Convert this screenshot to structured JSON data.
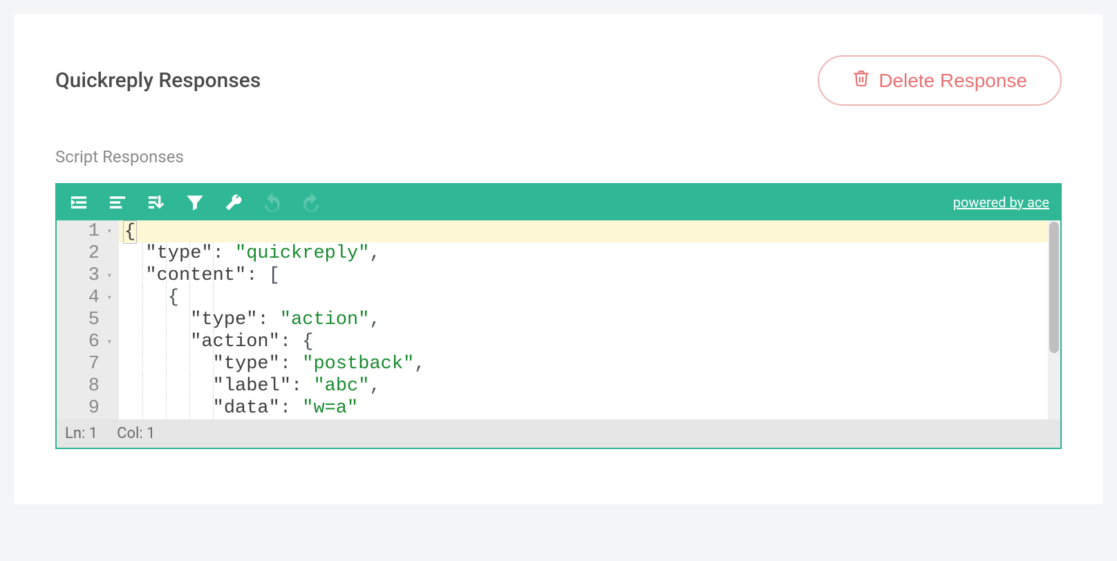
{
  "header": {
    "title": "Quickreply Responses",
    "delete_label": "Delete Response"
  },
  "section": {
    "label": "Script Responses"
  },
  "toolbar": {
    "powered_label": "powered by ace"
  },
  "editor": {
    "lines": [
      {
        "num": "1",
        "fold": true,
        "segments": [
          {
            "t": "{",
            "c": "key",
            "hl": true
          }
        ]
      },
      {
        "num": "2",
        "fold": false,
        "segments": [
          {
            "t": "  ",
            "c": ""
          },
          {
            "t": "\"type\"",
            "c": "key"
          },
          {
            "t": ": ",
            "c": "pun"
          },
          {
            "t": "\"quickreply\"",
            "c": "str"
          },
          {
            "t": ",",
            "c": "pun"
          }
        ]
      },
      {
        "num": "3",
        "fold": true,
        "segments": [
          {
            "t": "  ",
            "c": ""
          },
          {
            "t": "\"content\"",
            "c": "key"
          },
          {
            "t": ": [",
            "c": "pun"
          }
        ]
      },
      {
        "num": "4",
        "fold": true,
        "segments": [
          {
            "t": "    {",
            "c": "pun"
          }
        ]
      },
      {
        "num": "5",
        "fold": false,
        "segments": [
          {
            "t": "      ",
            "c": ""
          },
          {
            "t": "\"type\"",
            "c": "key"
          },
          {
            "t": ": ",
            "c": "pun"
          },
          {
            "t": "\"action\"",
            "c": "str"
          },
          {
            "t": ",",
            "c": "pun"
          }
        ]
      },
      {
        "num": "6",
        "fold": true,
        "segments": [
          {
            "t": "      ",
            "c": ""
          },
          {
            "t": "\"action\"",
            "c": "key"
          },
          {
            "t": ": {",
            "c": "pun"
          }
        ]
      },
      {
        "num": "7",
        "fold": false,
        "segments": [
          {
            "t": "        ",
            "c": ""
          },
          {
            "t": "\"type\"",
            "c": "key"
          },
          {
            "t": ": ",
            "c": "pun"
          },
          {
            "t": "\"postback\"",
            "c": "str"
          },
          {
            "t": ",",
            "c": "pun"
          }
        ]
      },
      {
        "num": "8",
        "fold": false,
        "segments": [
          {
            "t": "        ",
            "c": ""
          },
          {
            "t": "\"label\"",
            "c": "key"
          },
          {
            "t": ": ",
            "c": "pun"
          },
          {
            "t": "\"abc\"",
            "c": "str"
          },
          {
            "t": ",",
            "c": "pun"
          }
        ]
      },
      {
        "num": "9",
        "fold": false,
        "segments": [
          {
            "t": "        ",
            "c": ""
          },
          {
            "t": "\"data\"",
            "c": "key"
          },
          {
            "t": ": ",
            "c": "pun"
          },
          {
            "t": "\"w=a\"",
            "c": "str"
          }
        ]
      }
    ],
    "indent_guides": [
      34,
      68,
      102,
      136
    ],
    "active_line_index": 0
  },
  "statusbar": {
    "ln_label": "Ln: 1",
    "col_label": "Col: 1"
  }
}
